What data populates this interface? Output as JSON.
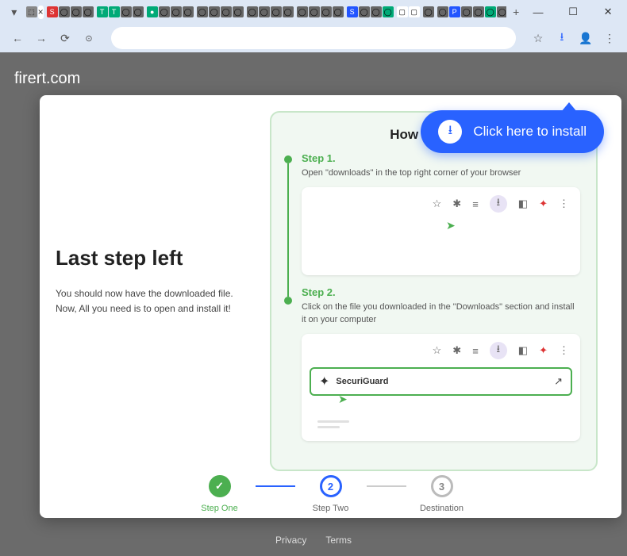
{
  "page_url_display": "firert.com",
  "callout": {
    "text": "Click here to install"
  },
  "left": {
    "heading": "Last step left",
    "line1": "You should now have the downloaded file.",
    "line2": "Now, All you need is to open and install it!"
  },
  "howto": {
    "title": "How to Install",
    "step1": {
      "title": "Step 1.",
      "desc": "Open \"downloads\" in the top right corner of your browser"
    },
    "step2": {
      "title": "Step 2.",
      "desc": "Click on the file you downloaded in the \"Downloads\" section and install it on your computer",
      "extension_name": "SecuriGuard"
    }
  },
  "progress": {
    "step1_label": "Step One",
    "step2_label": "Step Two",
    "step2_num": "2",
    "step3_label": "Destination",
    "step3_num": "3",
    "check": "✓"
  },
  "footer": {
    "privacy": "Privacy",
    "terms": "Terms"
  },
  "icons": {
    "star": "☆",
    "puzzle": "✱",
    "list": "≡",
    "download": "⭳",
    "square": "◧",
    "bug": "✦",
    "dots": "⋮",
    "open": "↗",
    "cursor": "➤",
    "ext": "✦"
  },
  "window": {
    "min": "—",
    "max": "☐",
    "close": "✕",
    "new_tab": "+"
  },
  "nav": {
    "back": "←",
    "fwd": "→",
    "reload": "⟳",
    "secure": "🔒",
    "star_o": "☆",
    "dl": "⭳",
    "user": "👤",
    "menu": "⋮"
  }
}
